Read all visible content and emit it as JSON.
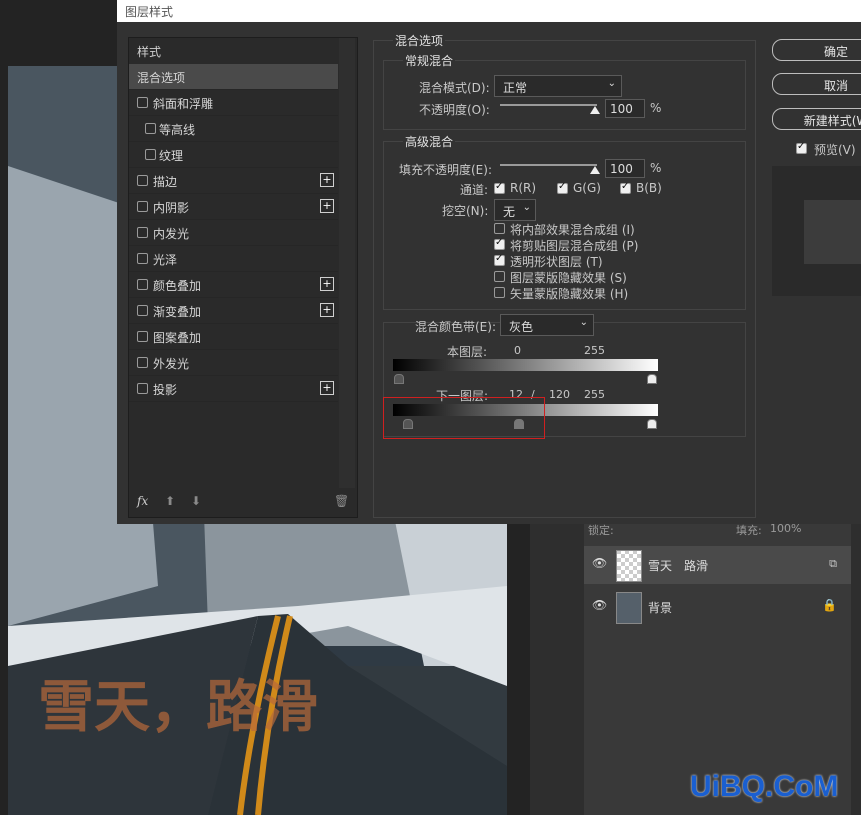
{
  "dialog": {
    "title": "图层样式",
    "styles_header": "样式",
    "styles": [
      {
        "label": "混合选项",
        "selected": true,
        "checkbox": false,
        "plus": false,
        "indent": false
      },
      {
        "label": "斜面和浮雕",
        "selected": false,
        "checkbox": true,
        "plus": false,
        "indent": false
      },
      {
        "label": "等高线",
        "selected": false,
        "checkbox": true,
        "plus": false,
        "indent": true
      },
      {
        "label": "纹理",
        "selected": false,
        "checkbox": true,
        "plus": false,
        "indent": true
      },
      {
        "label": "描边",
        "selected": false,
        "checkbox": true,
        "plus": true,
        "indent": false
      },
      {
        "label": "内阴影",
        "selected": false,
        "checkbox": true,
        "plus": true,
        "indent": false
      },
      {
        "label": "内发光",
        "selected": false,
        "checkbox": true,
        "plus": false,
        "indent": false
      },
      {
        "label": "光泽",
        "selected": false,
        "checkbox": true,
        "plus": false,
        "indent": false
      },
      {
        "label": "颜色叠加",
        "selected": false,
        "checkbox": true,
        "plus": true,
        "indent": false
      },
      {
        "label": "渐变叠加",
        "selected": false,
        "checkbox": true,
        "plus": true,
        "indent": false
      },
      {
        "label": "图案叠加",
        "selected": false,
        "checkbox": true,
        "plus": false,
        "indent": false
      },
      {
        "label": "外发光",
        "selected": false,
        "checkbox": true,
        "plus": false,
        "indent": false
      },
      {
        "label": "投影",
        "selected": false,
        "checkbox": true,
        "plus": true,
        "indent": false
      }
    ],
    "fx_label": "fx",
    "blend_options_title": "混合选项",
    "general_title": "常规混合",
    "blend_mode_label": "混合模式(D):",
    "blend_mode_value": "正常",
    "opacity_label": "不透明度(O):",
    "opacity_value": "100",
    "percent": "%",
    "advanced_title": "高级混合",
    "fill_opacity_label": "填充不透明度(E):",
    "fill_opacity_value": "100",
    "channels_label": "通道:",
    "channel_r": "R(R)",
    "channel_g": "G(G)",
    "channel_b": "B(B)",
    "knockout_label": "挖空(N):",
    "knockout_value": "无",
    "adv_options": [
      {
        "label": "将内部效果混合成组 (I)",
        "checked": false
      },
      {
        "label": "将剪贴图层混合成组 (P)",
        "checked": true
      },
      {
        "label": "透明形状图层 (T)",
        "checked": true
      },
      {
        "label": "图层蒙版隐藏效果 (S)",
        "checked": false
      },
      {
        "label": "矢量蒙版隐藏效果 (H)",
        "checked": false
      }
    ],
    "blend_if_label": "混合颜色带(E):",
    "blend_if_value": "灰色",
    "this_layer_label": "本图层:",
    "this_layer_low": "0",
    "this_layer_high": "255",
    "under_layer_label": "下一图层:",
    "under_layer_low_a": "12",
    "under_layer_sep": "/",
    "under_layer_low_b": "120",
    "under_layer_high": "255",
    "ok_button": "确定",
    "cancel_button": "取消",
    "new_style_button": "新建样式(W",
    "preview_label": "预览(V)",
    "preview_checked": true
  },
  "layers": {
    "lock_label": "锁定:",
    "fill_label": "填充:",
    "fill_value": "100%",
    "items": [
      {
        "name": "雪天　路滑",
        "visible": true,
        "icon": "smart-object-icon"
      },
      {
        "name": "背景",
        "visible": true,
        "icon": "lock-icon"
      }
    ]
  },
  "photo_text": "雪天，路滑",
  "watermark": "UiBQ.CoM",
  "colors": {
    "highlight_red": "#d02020",
    "watermark_blue": "#1a5fd0",
    "road_text": "#c8642a"
  }
}
